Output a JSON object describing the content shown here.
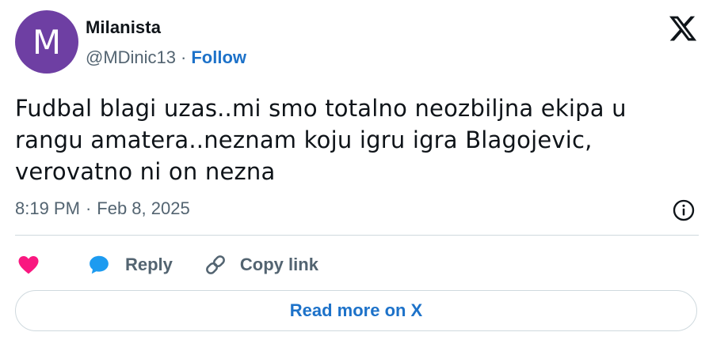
{
  "author": {
    "avatar_letter": "M",
    "avatar_color": "#6e3fa3",
    "display_name": "Milanista",
    "handle": "@MDinic13",
    "separator": "·",
    "follow_label": "Follow"
  },
  "brand": {
    "logo_icon": "x-logo-icon"
  },
  "tweet": {
    "lines": [
      "Fudbal blagi uzas..mi smo totalno neozbiljna ekipa u",
      "rangu amatera..neznam koju igru igra Blagojevic,",
      "verovatno ni on nezna"
    ],
    "time": "8:19 PM",
    "separator": "·",
    "date": "Feb 8, 2025"
  },
  "actions": {
    "like_icon": "heart-icon",
    "like_color": "#f91880",
    "reply_icon": "speech-bubble-icon",
    "reply_color": "#1d9bf0",
    "reply_label": "Reply",
    "copy_icon": "link-icon",
    "copy_label": "Copy link"
  },
  "read_more": {
    "label": "Read more on X"
  },
  "colors": {
    "accent": "#1d72c9",
    "muted_text": "#536471",
    "border": "#cfd9de"
  }
}
